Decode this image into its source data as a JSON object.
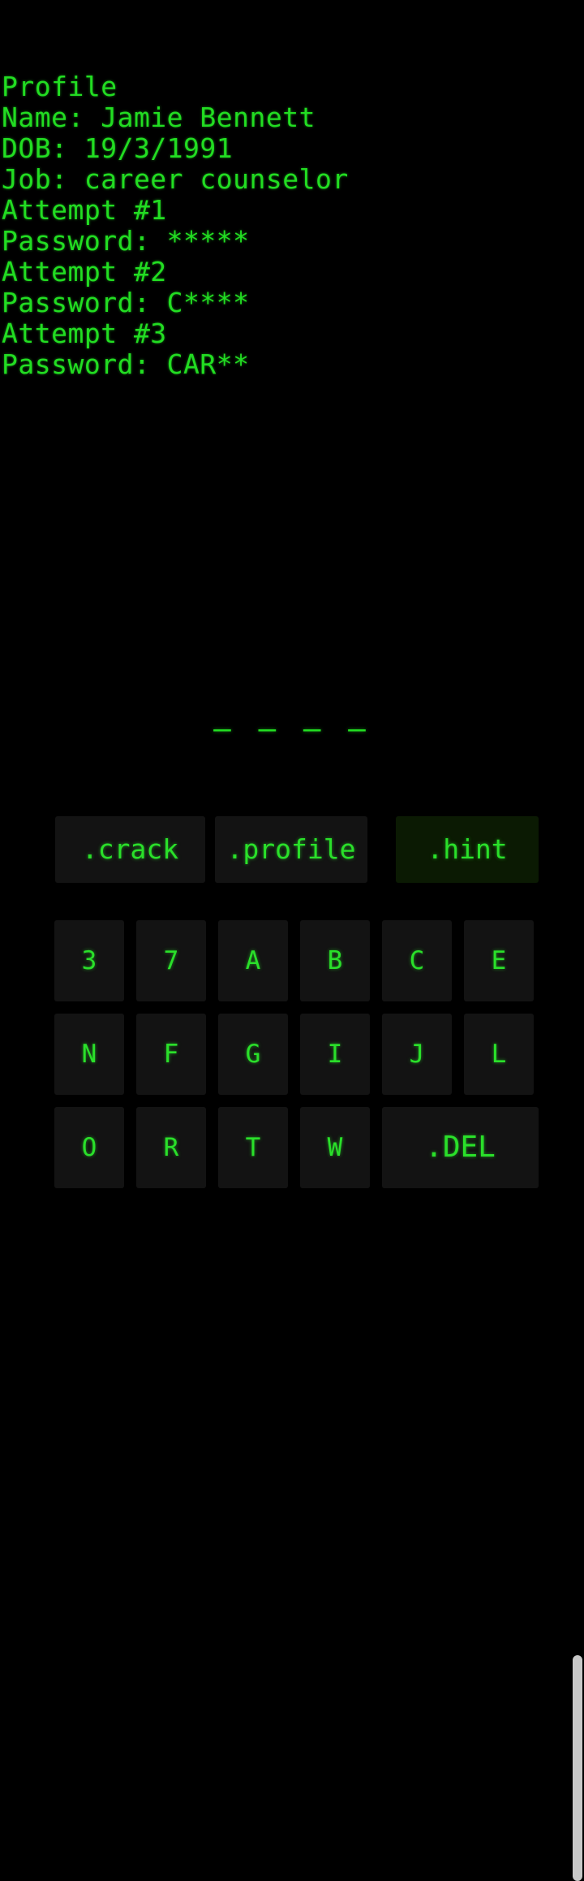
{
  "screen": {
    "background_color": "#000000",
    "terminal_green": "#22dd22",
    "key_background": "#131313",
    "active_key_background": "#0b1a03",
    "scrollbar_color": "#c8c8c8"
  },
  "console": {
    "lines": [
      "Profile",
      "Name: Jamie Bennett",
      "DOB: 19/3/1991",
      "Job: career counselor",
      "Attempt #1",
      "Password: *****",
      "Attempt #2",
      "Password: C****",
      "Attempt #3",
      "Password: CAR**"
    ],
    "profile": {
      "header": "Profile",
      "name_label": "Name:",
      "name_value": "Jamie Bennett",
      "dob_label": "DOB:",
      "dob_value": "19/3/1991",
      "job_label": "Job:",
      "job_value": "career counselor"
    },
    "attempts": [
      {
        "label": "Attempt #1",
        "password_label": "Password:",
        "password_value": "*****",
        "revealed": 0
      },
      {
        "label": "Attempt #2",
        "password_label": "Password:",
        "password_value": "C****",
        "revealed": 1
      },
      {
        "label": "Attempt #3",
        "password_label": "Password:",
        "password_value": "CAR**",
        "revealed": 3
      }
    ]
  },
  "progress": {
    "dashes": "— — — —",
    "slot_count": 4
  },
  "commands": [
    {
      "label": ".crack",
      "name": "crack",
      "active": false
    },
    {
      "label": ".profile",
      "name": "profile",
      "active": false
    },
    {
      "label": ".hint",
      "name": "hint",
      "active": true
    }
  ],
  "keypad": {
    "rows": [
      {
        "keys": [
          "3",
          "7",
          "A",
          "B",
          "C",
          "E"
        ]
      },
      {
        "keys": [
          "N",
          "F",
          "G",
          "I",
          "J",
          "L"
        ]
      },
      {
        "keys": [
          "O",
          "R",
          "T",
          "W",
          ".DEL"
        ]
      }
    ]
  }
}
